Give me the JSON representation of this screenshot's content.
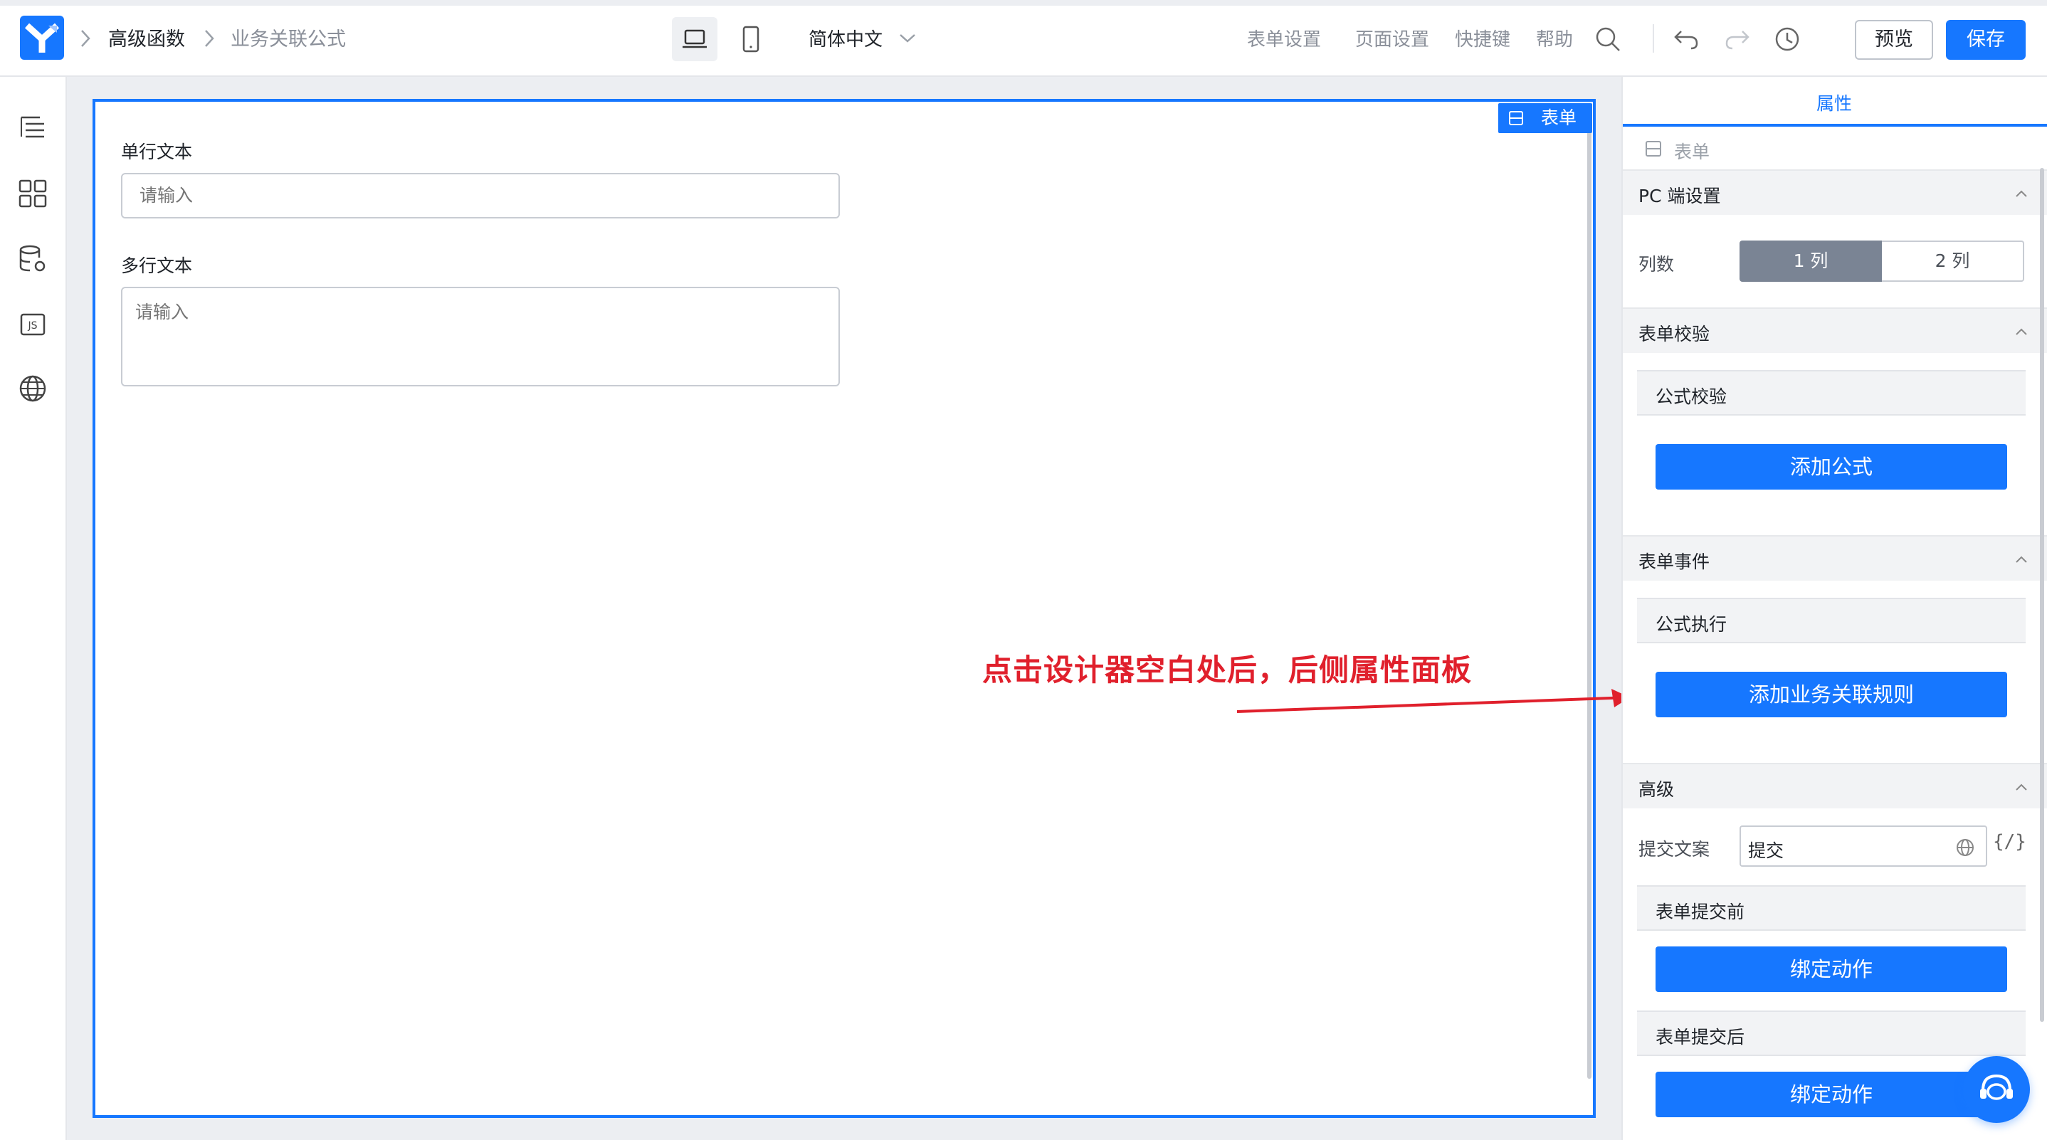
{
  "header": {
    "breadcrumb": [
      "高级函数",
      "业务关联公式"
    ],
    "language": "简体中文",
    "menu": [
      "表单设置",
      "页面设置",
      "快捷键",
      "帮助"
    ],
    "preview_label": "预览",
    "save_label": "保存"
  },
  "left_sidebar": {
    "icons": [
      "outline-icon",
      "components-icon",
      "datasource-icon",
      "js-icon",
      "globe-icon"
    ]
  },
  "canvas": {
    "tag_label": "表单",
    "fields": [
      {
        "label": "单行文本",
        "placeholder": "请输入"
      },
      {
        "label": "多行文本",
        "placeholder": "请输入"
      }
    ]
  },
  "annotation": {
    "text": "点击设计器空白处后，后侧属性面板",
    "color": "#e0202c"
  },
  "right_panel": {
    "tab": "属性",
    "breadcrumb": "表单",
    "pc_section": {
      "title": "PC 端设置",
      "columns_label": "列数",
      "options": [
        "1 列",
        "2 列"
      ],
      "selected": "1 列"
    },
    "validation": {
      "title": "表单校验",
      "sub_title": "公式校验",
      "button": "添加公式"
    },
    "events": {
      "title": "表单事件",
      "sub_title": "公式执行",
      "button": "添加业务关联规则"
    },
    "advanced": {
      "title": "高级",
      "submit_text_label": "提交文案",
      "submit_text_value": "提交",
      "expr_icon": "{/}",
      "before_submit": "表单提交前",
      "before_button": "绑定动作",
      "after_submit": "表单提交后",
      "after_button": "绑定动作"
    }
  },
  "colors": {
    "primary": "#1677ff",
    "selected_segment": "#7a8494"
  }
}
